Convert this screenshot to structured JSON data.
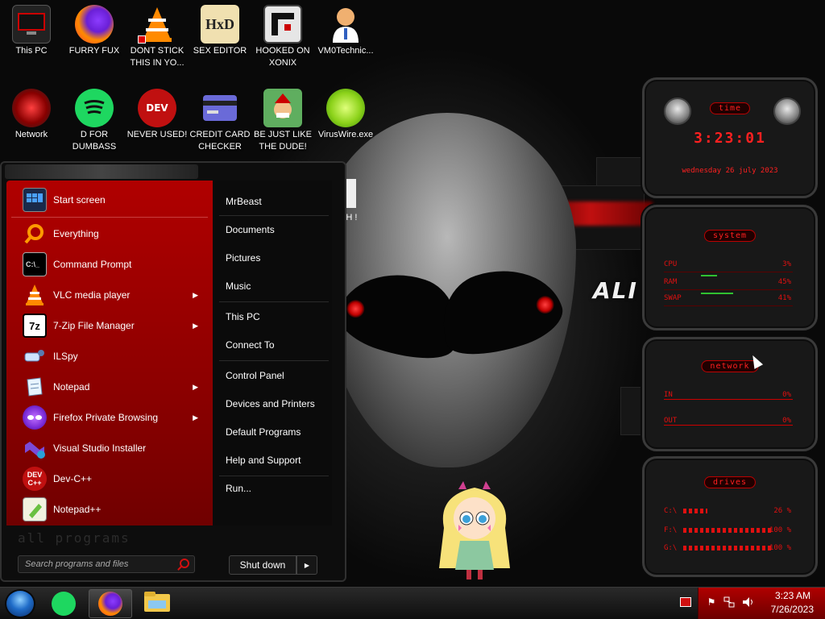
{
  "desktop": {
    "icons": [
      {
        "label": "This PC",
        "icon": "computer-icon"
      },
      {
        "label": "FURRY FUX",
        "icon": "firefox-icon"
      },
      {
        "label": "DONT STICK THIS IN YO...",
        "icon": "vlc-icon"
      },
      {
        "label": "SEX EDITOR",
        "icon": "hxd-icon"
      },
      {
        "label": "HOOKED ON XONIX",
        "icon": "game-icon"
      },
      {
        "label": "VM0Technic...",
        "icon": "doctor-icon"
      },
      {
        "label": "Network",
        "icon": "network-icon"
      },
      {
        "label": "D FOR DUMBASS",
        "icon": "spotify-icon"
      },
      {
        "label": "NEVER USED!",
        "icon": "devcpp-icon"
      },
      {
        "label": "CREDIT CARD CHECKER",
        "icon": "credit-card-icon"
      },
      {
        "label": "BE JUST LIKE THE DUDE!",
        "icon": "elf-icon"
      },
      {
        "label": "VirusWire.exe",
        "icon": "limewire-icon"
      }
    ],
    "wallpaper_text": "ALI",
    "partial_icon_label": "SH !"
  },
  "gadgets": {
    "time": {
      "title": "time",
      "clock": "3:23:01",
      "date": "wednesday 26 july 2023"
    },
    "system": {
      "title": "system",
      "rows": [
        {
          "label": "CPU",
          "value": "3%"
        },
        {
          "label": "RAM",
          "value": "45%"
        },
        {
          "label": "SWAP",
          "value": "41%"
        }
      ]
    },
    "network": {
      "title": "network",
      "rows": [
        {
          "label": "IN",
          "value": "0%"
        },
        {
          "label": "OUT",
          "value": "0%"
        }
      ]
    },
    "drives": {
      "title": "drives",
      "rows": [
        {
          "label": "C:\\",
          "value": "26 %"
        },
        {
          "label": "F:\\",
          "value": "100 %"
        },
        {
          "label": "G:\\",
          "value": "100 %"
        }
      ]
    }
  },
  "start_menu": {
    "programs": [
      {
        "label": "Start screen",
        "icon": "start-screen-icon",
        "submenu": false
      },
      {
        "label": "Everything",
        "icon": "magnifier-icon",
        "submenu": false
      },
      {
        "label": "Command Prompt",
        "icon": "command-prompt-icon",
        "submenu": false
      },
      {
        "label": "VLC media player",
        "icon": "vlc-icon",
        "submenu": true
      },
      {
        "label": "7-Zip File Manager",
        "icon": "7zip-icon",
        "submenu": true
      },
      {
        "label": "ILSpy",
        "icon": "ilspy-icon",
        "submenu": false
      },
      {
        "label": "Notepad",
        "icon": "notepad-icon",
        "submenu": true
      },
      {
        "label": "Firefox Private Browsing",
        "icon": "firefox-private-icon",
        "submenu": true
      },
      {
        "label": "Visual Studio Installer",
        "icon": "visual-studio-icon",
        "submenu": false
      },
      {
        "label": "Dev-C++",
        "icon": "devcpp-icon",
        "submenu": false
      },
      {
        "label": "Notepad++",
        "icon": "notepadpp-icon",
        "submenu": false
      }
    ],
    "links": [
      "MrBeast",
      "Documents",
      "Pictures",
      "Music",
      "This PC",
      "Connect To",
      "Control Panel",
      "Devices and Printers",
      "Default Programs",
      "Help and Support",
      "Run..."
    ],
    "all_programs": "all programs",
    "search_placeholder": "Search programs and files",
    "shutdown_label": "Shut down",
    "shutdown_arrow": "▶"
  },
  "taskbar": {
    "pinned": [
      "spotify-icon",
      "firefox-icon",
      "file-explorer-icon"
    ],
    "clock_time": "3:23 AM",
    "clock_date": "7/26/2023",
    "tray_icons": [
      "flag-icon",
      "network-icon",
      "volume-icon"
    ]
  },
  "colors": {
    "accent": "#c00000",
    "accent_bright": "#ff2020",
    "panel": "#181818"
  }
}
